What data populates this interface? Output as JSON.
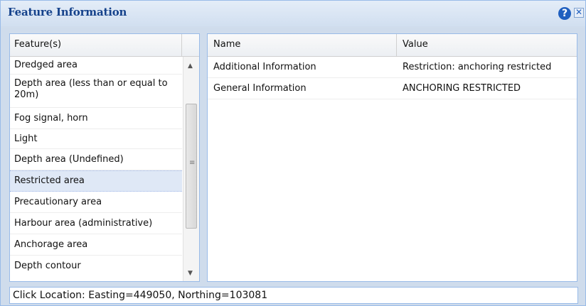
{
  "window": {
    "title": "Feature Information",
    "help_label": "?",
    "close_label": "✕"
  },
  "feature_panel": {
    "header": "Feature(s)",
    "items": [
      "Dredged area",
      "Depth area (less than or equal to 20m)",
      "Fog signal, horn",
      "Light",
      "Depth area (Undefined)",
      "Restricted area",
      "Precautionary area",
      "Harbour area (administrative)",
      "Anchorage area",
      "Depth contour"
    ],
    "selected": "Restricted area"
  },
  "attribute_panel": {
    "columns": [
      "Name",
      "Value"
    ],
    "rows": [
      {
        "name": "Additional Information",
        "value": "Restriction: anchoring restricted"
      },
      {
        "name": "General Information",
        "value": "ANCHORING RESTRICTED"
      }
    ]
  },
  "status_bar": {
    "text": "Click Location: Easting=449050, Northing=103081"
  },
  "scrollbar": {
    "up_icon": "▲",
    "down_icon": "▼",
    "grip_icon": "≡"
  }
}
